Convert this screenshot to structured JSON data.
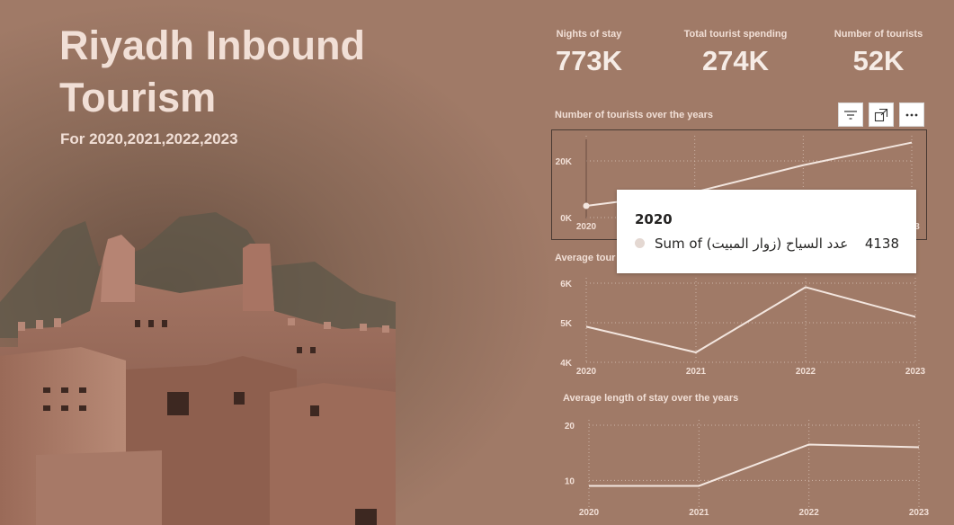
{
  "header": {
    "title_line1": "Riyadh Inbound",
    "title_line2": "Tourism",
    "subtitle": "For 2020,2021,2022,2023"
  },
  "kpis": [
    {
      "label": "Nights of stay",
      "value": "773K"
    },
    {
      "label": "Total tourist spending",
      "value": "274K"
    },
    {
      "label": "Number of tourists",
      "value": "52K"
    }
  ],
  "visual_toolbar": {
    "icons": [
      "filter-icon",
      "focus-mode-icon",
      "more-options-icon"
    ]
  },
  "tooltip": {
    "year": "2020",
    "label": "Sum of عدد السياح (زوار المبيت)",
    "value": "4138"
  },
  "colors": {
    "background": "#a07a67",
    "line": "#f3e6df",
    "text": "#f1dfd6"
  },
  "chart_data": [
    {
      "type": "line",
      "title": "Number of tourists over the years",
      "x": [
        "2020",
        "2021",
        "2022",
        "2023"
      ],
      "values": [
        4138,
        9000,
        18500,
        26500
      ],
      "yticks": [
        "0K",
        "20K"
      ],
      "ylim": [
        0,
        27000
      ],
      "grid": true,
      "x_labels_visible": [
        "2020",
        "3"
      ]
    },
    {
      "type": "line",
      "title": "Average tour",
      "x": [
        "2020",
        "2021",
        "2022",
        "2023"
      ],
      "values": [
        4900,
        4250,
        5900,
        5150
      ],
      "yticks": [
        "4K",
        "5K",
        "6K"
      ],
      "ylim": [
        4000,
        6000
      ],
      "grid": true
    },
    {
      "type": "line",
      "title": "Average length of stay over the years",
      "x": [
        "2020",
        "2021",
        "2022",
        "2023"
      ],
      "values": [
        9,
        9,
        16.5,
        16
      ],
      "yticks": [
        "10",
        "20"
      ],
      "ylim": [
        5,
        20
      ],
      "grid": true
    }
  ]
}
